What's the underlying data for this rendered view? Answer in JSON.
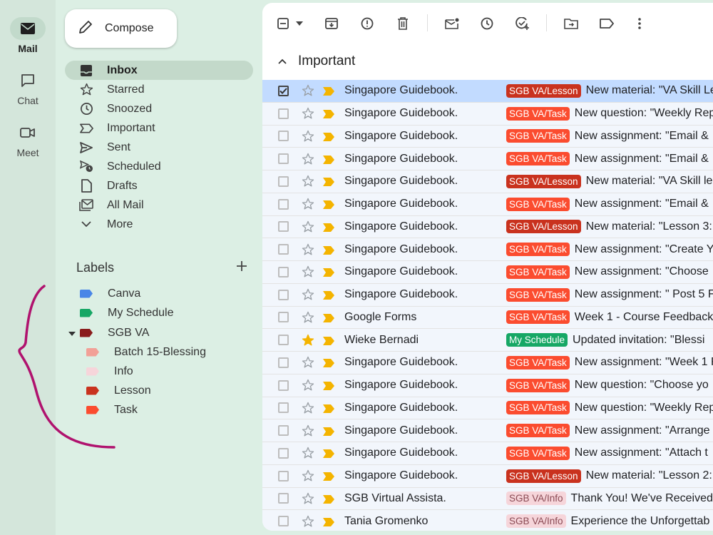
{
  "rail": [
    {
      "label": "Mail",
      "icon": "mail-icon",
      "active": true
    },
    {
      "label": "Chat",
      "icon": "chat-icon",
      "active": false
    },
    {
      "label": "Meet",
      "icon": "video-icon",
      "active": false
    }
  ],
  "compose_label": "Compose",
  "nav": [
    {
      "label": "Inbox",
      "icon": "inbox-icon",
      "active": true
    },
    {
      "label": "Starred",
      "icon": "star-icon"
    },
    {
      "label": "Snoozed",
      "icon": "clock-icon"
    },
    {
      "label": "Important",
      "icon": "important-icon"
    },
    {
      "label": "Sent",
      "icon": "send-icon"
    },
    {
      "label": "Scheduled",
      "icon": "scheduled-icon"
    },
    {
      "label": "Drafts",
      "icon": "draft-icon"
    },
    {
      "label": "All Mail",
      "icon": "all-mail-icon"
    },
    {
      "label": "More",
      "icon": "chevron-down-icon"
    }
  ],
  "labels_title": "Labels",
  "labels": [
    {
      "label": "Canva",
      "color": "#4986e7",
      "indent": 0
    },
    {
      "label": "My Schedule",
      "color": "#16a765",
      "indent": 0
    },
    {
      "label": "SGB VA",
      "color": "#8a1c1c",
      "indent": 0,
      "expanded": true
    },
    {
      "label": "Batch 15-Blessing",
      "color": "#f2a097",
      "indent": 1
    },
    {
      "label": "Info",
      "color": "#f6d5da",
      "indent": 1
    },
    {
      "label": "Lesson",
      "color": "#c9321e",
      "indent": 1
    },
    {
      "label": "Task",
      "color": "#fb4c2f",
      "indent": 1
    }
  ],
  "section_title": "Important",
  "emails": [
    {
      "sender": "Singapore Guidebook.",
      "label": "SGB VA/Lesson",
      "kind": "lesson",
      "subject": "New material: \"VA Skill Le",
      "selected": true,
      "starred": false
    },
    {
      "sender": "Singapore Guidebook.",
      "label": "SGB VA/Task",
      "kind": "task",
      "subject": "New question: \"Weekly Rep",
      "starred": false
    },
    {
      "sender": "Singapore Guidebook.",
      "label": "SGB VA/Task",
      "kind": "task",
      "subject": "New assignment: \"Email &",
      "starred": false
    },
    {
      "sender": "Singapore Guidebook.",
      "label": "SGB VA/Task",
      "kind": "task",
      "subject": "New assignment: \"Email &",
      "starred": false
    },
    {
      "sender": "Singapore Guidebook.",
      "label": "SGB VA/Lesson",
      "kind": "lesson",
      "subject": "New material: \"VA Skill le",
      "starred": false
    },
    {
      "sender": "Singapore Guidebook.",
      "label": "SGB VA/Task",
      "kind": "task",
      "subject": "New assignment: \"Email &",
      "starred": false
    },
    {
      "sender": "Singapore Guidebook.",
      "label": "SGB VA/Lesson",
      "kind": "lesson",
      "subject": "New material: \"Lesson 3:",
      "starred": false
    },
    {
      "sender": "Singapore Guidebook.",
      "label": "SGB VA/Task",
      "kind": "task",
      "subject": "New assignment: \"Create Y",
      "starred": false
    },
    {
      "sender": "Singapore Guidebook.",
      "label": "SGB VA/Task",
      "kind": "task",
      "subject": "New assignment: \"Choose",
      "starred": false
    },
    {
      "sender": "Singapore Guidebook.",
      "label": "SGB VA/Task",
      "kind": "task",
      "subject": "New assignment: \" Post 5 F",
      "starred": false
    },
    {
      "sender": "Google Forms",
      "label": "SGB VA/Task",
      "kind": "task",
      "subject": "Week 1 - Course Feedback",
      "starred": false
    },
    {
      "sender": "Wieke Bernadi",
      "label": "My Schedule",
      "kind": "sched",
      "subject": "Updated invitation: \"Blessi",
      "starred": true
    },
    {
      "sender": "Singapore Guidebook.",
      "label": "SGB VA/Task",
      "kind": "task",
      "subject": "New assignment: \"Week 1 F",
      "starred": false
    },
    {
      "sender": "Singapore Guidebook.",
      "label": "SGB VA/Task",
      "kind": "task",
      "subject": "New question: \"Choose yo",
      "starred": false
    },
    {
      "sender": "Singapore Guidebook.",
      "label": "SGB VA/Task",
      "kind": "task",
      "subject": "New question: \"Weekly Rep",
      "starred": false
    },
    {
      "sender": "Singapore Guidebook.",
      "label": "SGB VA/Task",
      "kind": "task",
      "subject": "New assignment: \"Arrange",
      "starred": false
    },
    {
      "sender": "Singapore Guidebook.",
      "label": "SGB VA/Task",
      "kind": "task",
      "subject": "New assignment: \"Attach t",
      "starred": false
    },
    {
      "sender": "Singapore Guidebook.",
      "label": "SGB VA/Lesson",
      "kind": "lesson",
      "subject": "New material: \"Lesson 2:",
      "starred": false
    },
    {
      "sender": "SGB Virtual Assista.",
      "label": "SGB VA/Info",
      "kind": "info",
      "subject": "Thank You! We've Received",
      "starred": false
    },
    {
      "sender": "Tania Gromenko",
      "label": "SGB VA/Info",
      "kind": "info",
      "subject": "Experience the Unforgettab",
      "starred": false
    }
  ],
  "colors": {
    "accent_important": "#f4b400",
    "star_filled": "#f4b400",
    "annotation": "#b0126e"
  }
}
